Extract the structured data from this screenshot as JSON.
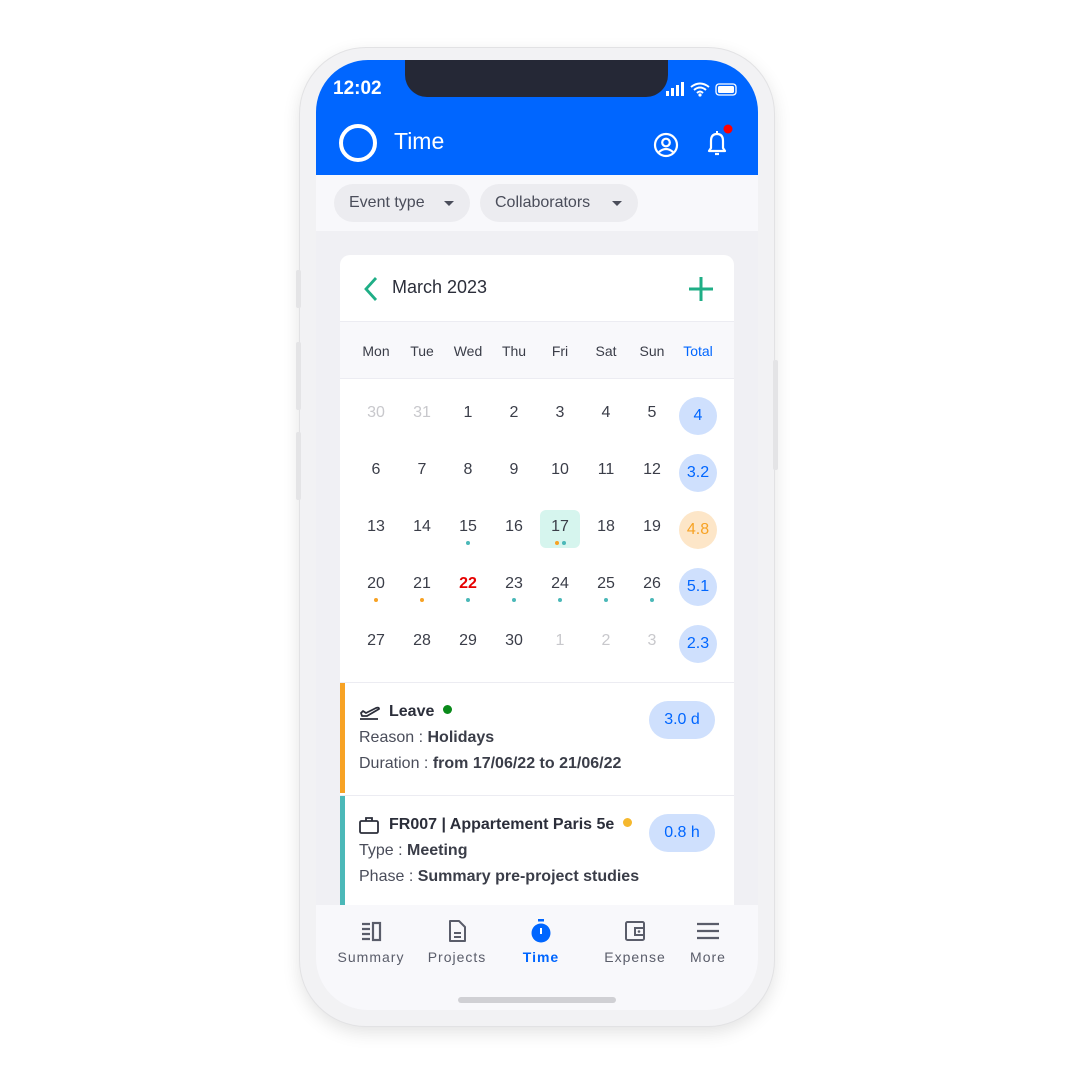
{
  "status": {
    "time": "12:02"
  },
  "header": {
    "title": "Time",
    "notification_dot_color": "#ff0000"
  },
  "filters": [
    {
      "label": "Event type"
    },
    {
      "label": "Collaborators"
    }
  ],
  "calendar": {
    "month": "March 2023",
    "weekdays": [
      "Mon",
      "Tue",
      "Wed",
      "Thu",
      "Fri",
      "Sat",
      "Sun"
    ],
    "total_label": "Total",
    "weeks": [
      {
        "days": [
          {
            "d": "30",
            "dim": true
          },
          {
            "d": "31",
            "dim": true
          },
          {
            "d": "1"
          },
          {
            "d": "2"
          },
          {
            "d": "3"
          },
          {
            "d": "4"
          },
          {
            "d": "5"
          }
        ],
        "total": "4",
        "total_status": "normal"
      },
      {
        "days": [
          {
            "d": "6"
          },
          {
            "d": "7"
          },
          {
            "d": "8"
          },
          {
            "d": "9"
          },
          {
            "d": "10"
          },
          {
            "d": "11"
          },
          {
            "d": "12"
          }
        ],
        "total": "3.2",
        "total_status": "normal"
      },
      {
        "days": [
          {
            "d": "13"
          },
          {
            "d": "14"
          },
          {
            "d": "15",
            "dots": [
              "teal"
            ]
          },
          {
            "d": "16"
          },
          {
            "d": "17",
            "selected": true,
            "dots": [
              "orange",
              "teal"
            ]
          },
          {
            "d": "18"
          },
          {
            "d": "19"
          }
        ],
        "total": "4.8",
        "total_status": "warning"
      },
      {
        "days": [
          {
            "d": "20",
            "dots": [
              "orange"
            ]
          },
          {
            "d": "21",
            "dots": [
              "orange"
            ]
          },
          {
            "d": "22",
            "today": true,
            "dots": [
              "teal"
            ]
          },
          {
            "d": "23",
            "dots": [
              "teal"
            ]
          },
          {
            "d": "24",
            "dots": [
              "teal"
            ]
          },
          {
            "d": "25",
            "dots": [
              "teal"
            ]
          },
          {
            "d": "26",
            "dots": [
              "teal"
            ]
          }
        ],
        "total": "5.1",
        "total_status": "normal"
      },
      {
        "days": [
          {
            "d": "27"
          },
          {
            "d": "28"
          },
          {
            "d": "29"
          },
          {
            "d": "30"
          },
          {
            "d": "1",
            "dim": true
          },
          {
            "d": "2",
            "dim": true
          },
          {
            "d": "3",
            "dim": true
          }
        ],
        "total": "2.3",
        "total_status": "normal"
      }
    ]
  },
  "events": [
    {
      "title": "Leave",
      "status_color": "#0a8a1a",
      "bar_color": "#f7a224",
      "icon": "flight-takeoff-icon",
      "line1_label": "Reason : ",
      "line1_value": "Holidays",
      "line2_label": "Duration : ",
      "line2_value": "from 17/06/22 to 21/06/22",
      "amount": "3.0 d"
    },
    {
      "title": "FR007 | Appartement Paris 5e",
      "status_color": "#f5b82e",
      "bar_color": "#4bb8b8",
      "icon": "briefcase-icon",
      "line1_label": "Type : ",
      "line1_value": "Meeting",
      "line2_label": "Phase : ",
      "line2_value": "Summary pre-project studies",
      "amount": "0.8 h"
    }
  ],
  "nav": [
    {
      "label": "Summary"
    },
    {
      "label": "Projects"
    },
    {
      "label": "Time",
      "active": true
    },
    {
      "label": "Expense"
    },
    {
      "label": "More"
    }
  ],
  "colors": {
    "primary": "#0066ff",
    "accent": "#1fae86",
    "orange": "#f7a224",
    "teal": "#4bb8b8",
    "today": "#e60000"
  }
}
